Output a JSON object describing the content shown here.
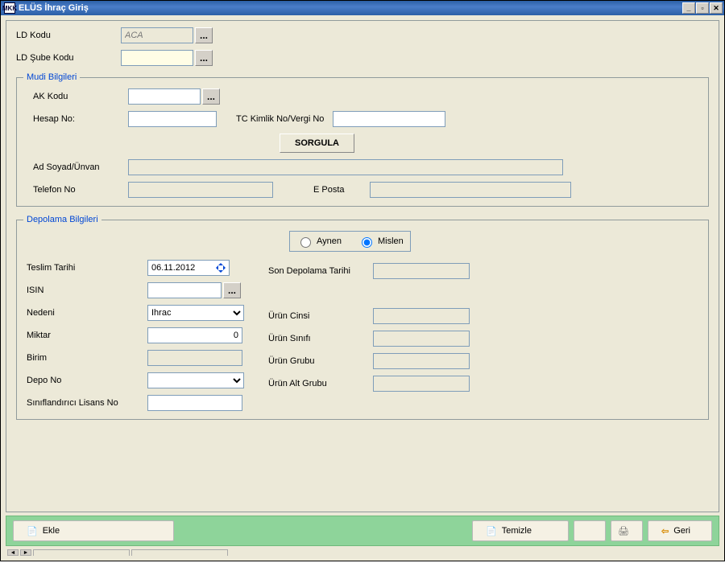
{
  "window": {
    "title": "ELÜS İhraç Giriş",
    "appIconText": "MKK"
  },
  "top": {
    "ldKoduLabel": "LD Kodu",
    "ldKoduValue": "ACA",
    "ldSubeKoduLabel": "LD Şube Kodu",
    "ldSubeKoduValue": ""
  },
  "mudi": {
    "legend": "Mudi Bilgileri",
    "akKoduLabel": "AK Kodu",
    "akKoduValue": "",
    "hesapNoLabel": "Hesap No:",
    "hesapNoValue": "",
    "tcKimlikLabel": "TC Kimlik No/Vergi No",
    "tcKimlikValue": "",
    "sorgulaLabel": "SORGULA",
    "adSoyadLabel": "Ad Soyad/Ünvan",
    "adSoyadValue": "",
    "telefonLabel": "Telefon No",
    "telefonValue": "",
    "ePostaLabel": "E Posta",
    "ePostaValue": ""
  },
  "depolama": {
    "legend": "Depolama Bilgileri",
    "radio": {
      "aynenLabel": "Aynen",
      "mislenLabel": "Mislen",
      "selected": "mislen"
    },
    "teslimTarihiLabel": "Teslim Tarihi",
    "teslimTarihiValue": "06.11.2012",
    "isinLabel": "ISIN",
    "isinValue": "",
    "nedeniLabel": "Nedeni",
    "nedeniValue": "Ihrac",
    "miktarLabel": "Miktar",
    "miktarValue": "0",
    "birimLabel": "Birim",
    "birimValue": "",
    "depoNoLabel": "Depo No",
    "depoNoValue": "",
    "siniflandiriciLabel": "Sınıflandırıcı Lisans No",
    "siniflandiriciValue": "",
    "sonDepolamaLabel": "Son Depolama Tarihi",
    "sonDepolamaValue": "",
    "urunCinsiLabel": "Ürün Cinsi",
    "urunCinsiValue": "",
    "urunSinifiLabel": "Ürün Sınıfı",
    "urunSinifiValue": "",
    "urunGrubuLabel": "Ürün Grubu",
    "urunGrubuValue": "",
    "urunAltGrubuLabel": "Ürün Alt Grubu",
    "urunAltGrubuValue": ""
  },
  "footer": {
    "ekleLabel": "Ekle",
    "temizleLabel": "Temizle",
    "geriLabel": "Geri"
  }
}
